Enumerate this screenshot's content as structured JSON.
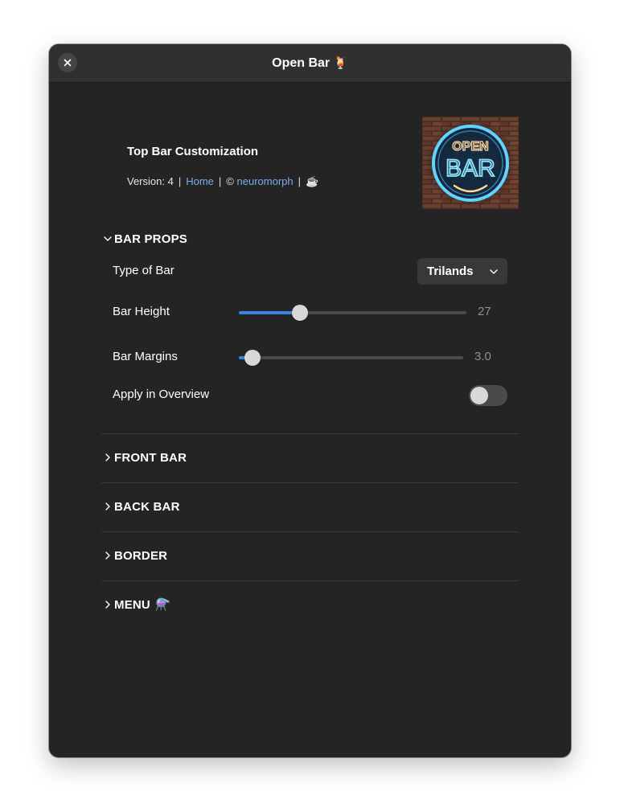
{
  "window": {
    "title": "Open Bar",
    "title_emoji": "🍹"
  },
  "header": {
    "title": "Top Bar Customization",
    "version_label": "Version: 4",
    "separator": "|",
    "home_link": "Home",
    "copyright_symbol": "©",
    "author_link": "neuromorph",
    "coffee_emoji": "☕",
    "logo": {
      "line1": "OPEN",
      "line2": "BAR"
    }
  },
  "sections": {
    "bar_props": {
      "label": "BAR PROPS",
      "expanded": true,
      "type_of_bar": {
        "label": "Type of Bar",
        "selected": "Trilands"
      },
      "bar_height": {
        "label": "Bar Height",
        "value": "27",
        "fraction": 0.27
      },
      "bar_margins": {
        "label": "Bar Margins",
        "value": "3.0",
        "fraction": 0.06
      },
      "apply_in_overview": {
        "label": "Apply in Overview",
        "enabled": false
      }
    },
    "front_bar": {
      "label": "FRONT BAR",
      "expanded": false
    },
    "back_bar": {
      "label": "BACK BAR",
      "expanded": false
    },
    "border": {
      "label": "BORDER",
      "expanded": false
    },
    "menu": {
      "label": "MENU",
      "emoji": "⚗️",
      "expanded": false
    }
  },
  "colors": {
    "accent": "#3584e4",
    "link": "#78aeed",
    "window_bg": "#242424",
    "titlebar_bg": "#303030"
  },
  "icons": {
    "close": "close-icon",
    "expanded": "chevron-down-icon",
    "collapsed": "chevron-right-icon",
    "dropdown": "chevron-down-icon"
  }
}
